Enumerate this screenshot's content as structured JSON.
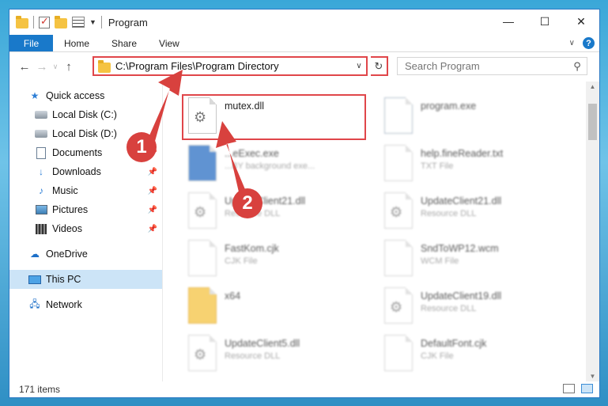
{
  "window": {
    "title": "Program",
    "minimize_glyph": "—",
    "maximize_glyph": "☐",
    "close_glyph": "✕"
  },
  "ribbon": {
    "file_tab": "File",
    "tabs": [
      "Home",
      "Share",
      "View"
    ],
    "help_glyph": "?"
  },
  "nav": {
    "address": "C:\\Program Files\\Program Directory",
    "search_placeholder": "Search Program"
  },
  "sidebar": {
    "quick_access": "Quick access",
    "items": [
      {
        "label": "Local Disk (C:)",
        "icon": "disk-icon"
      },
      {
        "label": "Local Disk (D:)",
        "icon": "disk-icon"
      },
      {
        "label": "Documents",
        "icon": "documents-icon"
      },
      {
        "label": "Downloads",
        "icon": "downloads-icon"
      },
      {
        "label": "Music",
        "icon": "music-icon"
      },
      {
        "label": "Pictures",
        "icon": "pictures-icon"
      },
      {
        "label": "Videos",
        "icon": "videos-icon"
      }
    ],
    "onedrive": "OneDrive",
    "this_pc": "This PC",
    "network": "Network"
  },
  "files": [
    {
      "name": "mutex.dll",
      "type": ""
    },
    {
      "name": "program.exe",
      "type": ""
    },
    {
      "name": "...eExec.exe",
      "type": "...BY background exe..."
    },
    {
      "name": "help.fineReader.txt",
      "type": "TXT File"
    },
    {
      "name": "UpdateClient21.dll",
      "type": "Resource DLL"
    },
    {
      "name": "UpdateClient21.dll",
      "type": "Resource DLL"
    },
    {
      "name": "FastKom.cjk",
      "type": "CJK File"
    },
    {
      "name": "SndToWP12.wcm",
      "type": "WCM File"
    },
    {
      "name": "x64",
      "type": ""
    },
    {
      "name": "UpdateClient19.dll",
      "type": "Resource DLL"
    },
    {
      "name": "UpdateClient5.dll",
      "type": "Resource DLL"
    },
    {
      "name": "DefaultFont.cjk",
      "type": "CJK File"
    }
  ],
  "callouts": [
    "1",
    "2"
  ],
  "status": {
    "item_count": "171 items"
  },
  "colors": {
    "accent": "#1979ca",
    "highlight_red": "#e0464a",
    "selection": "#cce4f7"
  }
}
